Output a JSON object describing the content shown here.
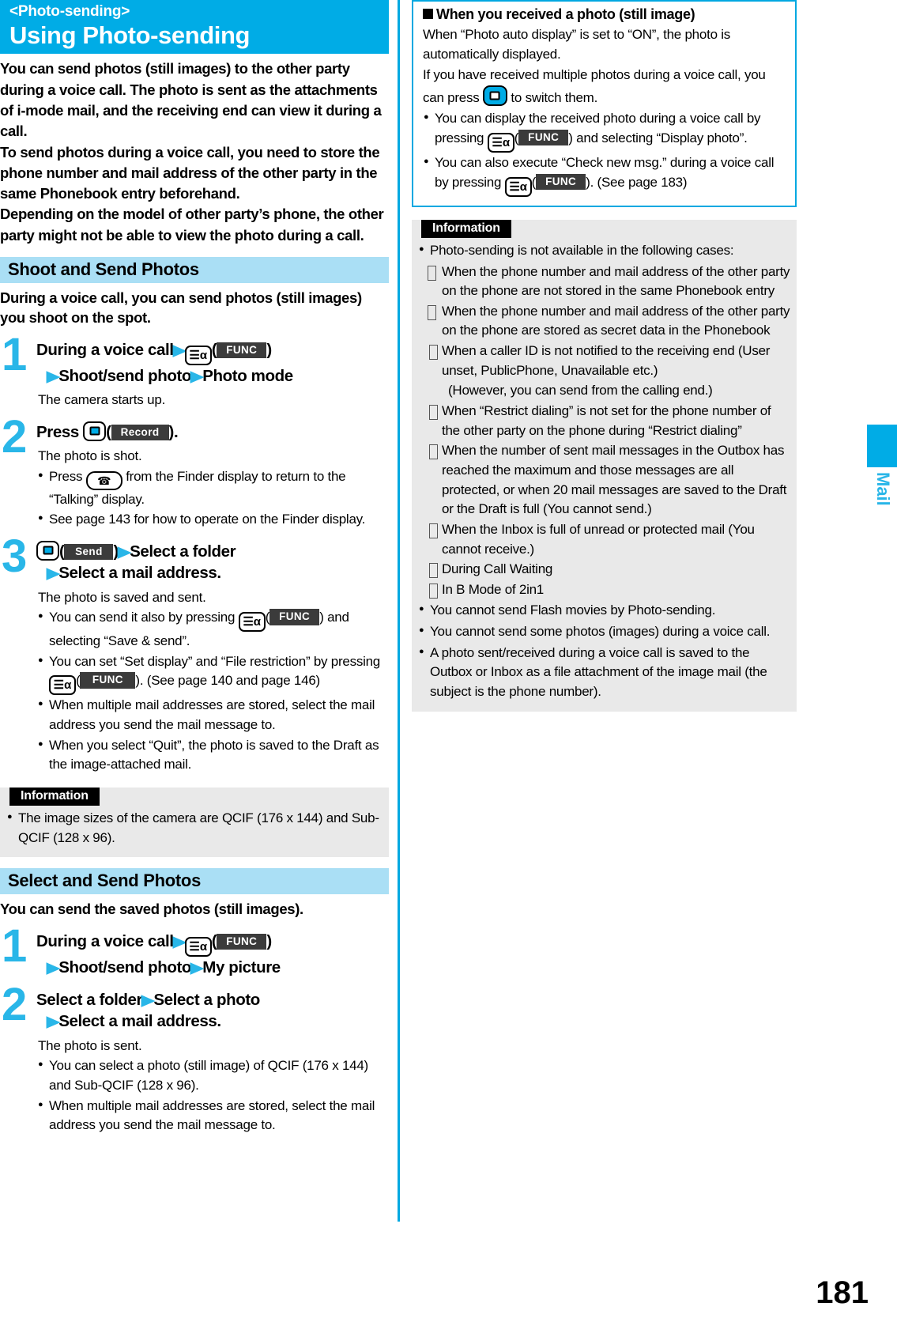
{
  "header": {
    "kicker": "<Photo-sending>",
    "title": "Using Photo-sending",
    "accent_color": "#00ace6"
  },
  "lead": [
    "You can send photos (still images) to the other party during a voice call. The photo is sent as the attachments of i-mode mail, and the receiving end can view it during a call.",
    "To send photos during a voice call, you need to store the phone number and mail address of the other party in the same Phonebook entry beforehand.",
    "Depending on the model of other party’s phone, the other party might not be able to view the photo during a call."
  ],
  "sections": [
    {
      "heading": "Shoot and Send Photos",
      "intro": "During a voice call, you can send photos (still images) you shoot on the spot.",
      "steps": [
        {
          "num": "1",
          "line1_pre": "During a voice call",
          "key": "i-mode-alpha-key",
          "softkey": "FUNC",
          "line2_a": "Shoot/send photo",
          "line2_b": "Photo mode",
          "body": [
            {
              "type": "plain",
              "text": "The camera starts up."
            }
          ]
        },
        {
          "num": "2",
          "press_label": "Press",
          "key": "center-key",
          "softkey": "Record",
          "trailing": ").",
          "body": [
            {
              "type": "plain",
              "text": "The photo is shot."
            },
            {
              "type": "bullet-key-tel",
              "pre": "Press",
              "post": "from the Finder display to return to the “Talking” display."
            },
            {
              "type": "bullet",
              "text": "See page 143 for how to operate on the Finder display."
            }
          ]
        },
        {
          "num": "3",
          "key": "center-key",
          "softkey": "Send",
          "line1_b": "Select a folder",
          "line2": "Select a mail address.",
          "body": [
            {
              "type": "plain",
              "text": "The photo is saved and sent."
            },
            {
              "type": "bullet-func",
              "pre": "You can send it also by pressing",
              "softkey": "FUNC",
              "post": ") and selecting “Save & send”."
            },
            {
              "type": "bullet-func2",
              "pre": "You can set “Set display” and “File restriction” by pressing",
              "softkey": "FUNC",
              "post": "). (See page 140 and page 146)"
            },
            {
              "type": "bullet",
              "text": "When multiple mail addresses are stored, select the mail address you send the mail message to."
            },
            {
              "type": "bullet",
              "text": "When you select “Quit”, the photo is saved to the Draft as the image-attached mail."
            }
          ]
        }
      ],
      "information": {
        "tag": "Information",
        "items": [
          "The image sizes of the camera are QCIF (176 x 144) and Sub-QCIF (128 x 96)."
        ]
      }
    },
    {
      "heading": "Select and Send Photos",
      "intro": "You can send the saved photos (still images).",
      "steps": [
        {
          "num": "1",
          "line1_pre": "During a voice call",
          "key": "i-mode-alpha-key",
          "softkey": "FUNC",
          "line2_a": "Shoot/send photo",
          "line2_b": "My picture",
          "body": []
        },
        {
          "num": "2",
          "line1_a": "Select a folder",
          "line1_b": "Select a photo",
          "line2": "Select a mail address.",
          "body": [
            {
              "type": "plain",
              "text": "The photo is sent."
            },
            {
              "type": "bullet",
              "text": "You can select a photo (still image) of QCIF (176 x 144) and Sub-QCIF (128 x 96)."
            },
            {
              "type": "bullet",
              "text": "When multiple mail addresses are stored, select the mail address you send the mail message to."
            }
          ]
        }
      ]
    }
  ],
  "callout": {
    "heading": "When you received a photo (still image)",
    "paragraphs": [
      "When “Photo auto display” is set to “ON”, the photo is automatically displayed.",
      "If you have received multiple photos during a voice call, you can press"
    ],
    "nav_key_suffix": "to switch them.",
    "bullets": [
      {
        "pre": "You can display the received photo during a voice call by pressing",
        "softkey": "FUNC",
        "post": ") and selecting “Display photo”."
      },
      {
        "pre": "You can also execute “Check new msg.” during a voice call by pressing",
        "softkey": "FUNC",
        "post": "). (See page 183)"
      }
    ]
  },
  "right_information": {
    "tag": "Information",
    "lead": "Photo-sending is not available in the following cases:",
    "cases": [
      "When the phone number and mail address of the other party on the phone are not stored in the same Phonebook entry",
      "When the phone number and mail address of the other party on the phone are stored as secret data in the Phonebook",
      "When a caller ID is not notified to the receiving end (User unset, PublicPhone, Unavailable etc.)",
      "When “Restrict dialing” is not set for the phone number of the other party on the phone during “Restrict dialing”",
      "When the number of sent mail messages in the Outbox has reached the maximum and those messages are all protected, or when 20 mail messages are saved to the Draft or the Draft is full (You cannot send.)",
      "When the Inbox is full of unread or protected mail (You cannot receive.)",
      "During Call Waiting",
      "In B Mode of 2in1"
    ],
    "case_note": "(However, you can send from the calling end.)",
    "trailing_items": [
      "You cannot send Flash movies by Photo-sending.",
      "You cannot send some photos (images) during a voice call.",
      "A photo sent/received during a voice call is saved to the Outbox or Inbox as a file attachment of the image mail (the subject is the phone number)."
    ]
  },
  "side_tab": {
    "label": "Mail",
    "color": "#00ace6"
  },
  "page_number": "181",
  "icons": {
    "imode_glyph": "☰α",
    "tel_glyph": "☎",
    "arrow": "▶"
  }
}
